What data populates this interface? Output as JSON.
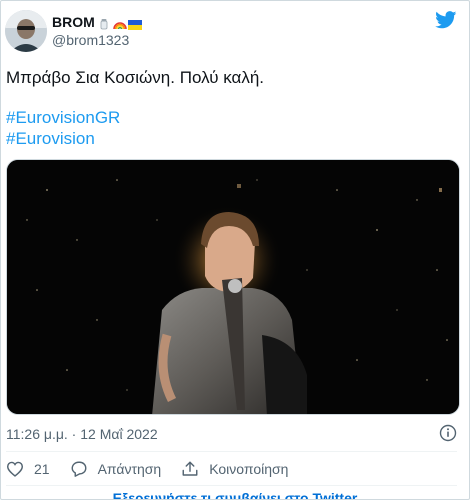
{
  "author": {
    "display_name": "BROM",
    "handle": "@brom1323",
    "badges": [
      "salt-shaker-emoji",
      "rainbow-emoji",
      "ukraine-flag-emoji"
    ]
  },
  "tweet": {
    "text": "Μπράβο Σια Κοσιώνη. Πολύ καλή.",
    "hashtags": [
      "#EurovisionGR",
      "#Eurovision"
    ]
  },
  "meta": {
    "timestamp": "11:26 μ.μ. · 12 Μαΐ 2022"
  },
  "actions": {
    "like_count": "21",
    "reply_label": "Απάντηση",
    "share_label": "Κοινοποίηση"
  },
  "footer": {
    "more_label": "Εξερευνήστε τι συμβαίνει στο Twitter"
  },
  "colors": {
    "accent": "#1d9bf0",
    "text": "#0f1419",
    "muted": "#536471"
  },
  "icons": [
    "twitter-bird-icon",
    "info-icon",
    "heart-icon",
    "reply-icon",
    "share-icon"
  ]
}
